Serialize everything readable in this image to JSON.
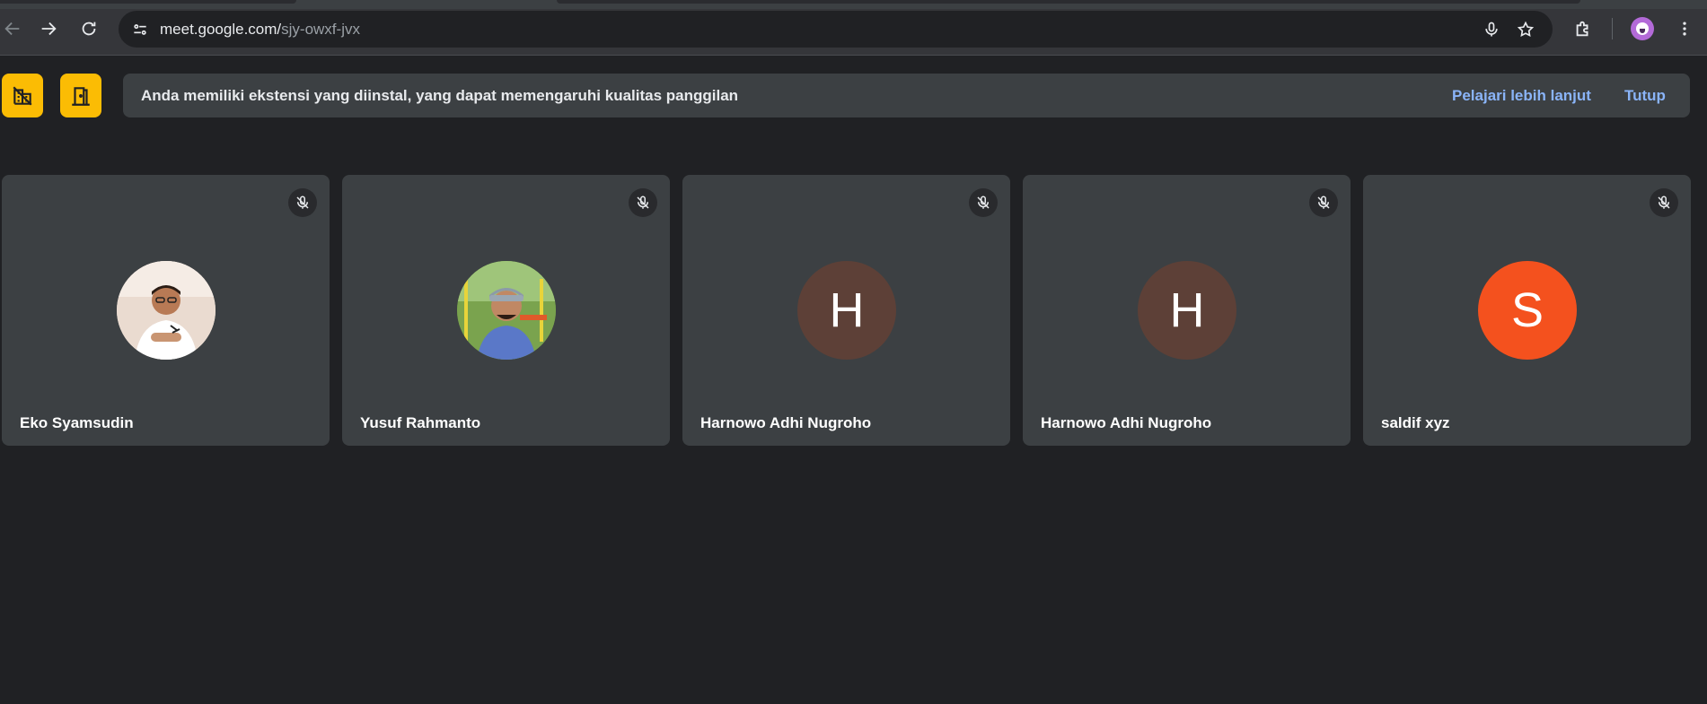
{
  "browser": {
    "url_host": "meet.google.com/",
    "url_path": "sjy-owxf-jvx",
    "icons": [
      "back-icon",
      "forward-icon",
      "reload-icon",
      "site-info-icon",
      "mic-icon",
      "star-icon",
      "extensions-icon",
      "profile-avatar",
      "more-icon"
    ]
  },
  "notification": {
    "message": "Anda memiliki ekstensi yang diinstal, yang dapat memengaruhi kualitas panggilan",
    "learn_more": "Pelajari lebih lanjut",
    "close": "Tutup"
  },
  "participants": [
    {
      "name": "Eko Syamsudin",
      "avatar_type": "photo",
      "muted": true
    },
    {
      "name": "Yusuf Rahmanto",
      "avatar_type": "photo",
      "muted": true
    },
    {
      "name": "Harnowo Adhi Nugroho",
      "avatar_type": "initial",
      "initial": "H",
      "avatar_color": "#5d4037",
      "muted": true
    },
    {
      "name": "Harnowo Adhi Nugroho",
      "avatar_type": "initial",
      "initial": "H",
      "avatar_color": "#5d4037",
      "muted": true
    },
    {
      "name": "saldif xyz",
      "avatar_type": "initial",
      "initial": "S",
      "avatar_color": "#f4511e",
      "muted": true
    }
  ],
  "colors": {
    "background": "#202124",
    "tile": "#3c4043",
    "accent_yellow": "#fbbc04",
    "link_blue": "#8ab4f8"
  }
}
